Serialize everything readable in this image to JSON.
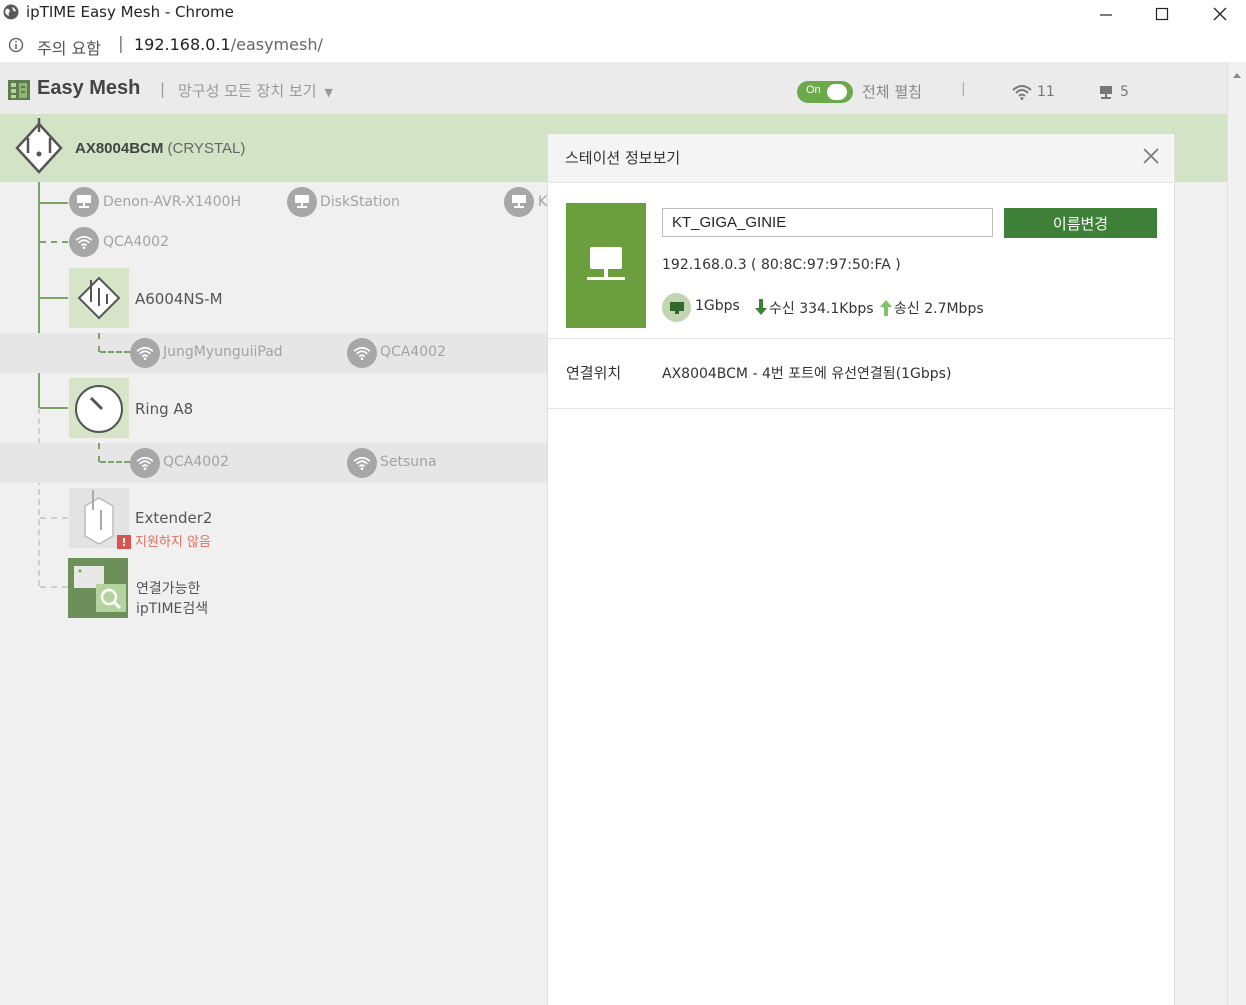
{
  "window": {
    "title": "ipTIME Easy Mesh - Chrome",
    "icon": "globe-icon",
    "controls": [
      "minimize-icon",
      "maximize-icon",
      "close-icon"
    ]
  },
  "address_bar": {
    "security_icon": "info-icon",
    "security_text": "주의 요함",
    "separator": "|",
    "host": "192.168.0.1",
    "path": "/easymesh/"
  },
  "header": {
    "logo_icon": "easymesh-logo-icon",
    "title": "Easy Mesh",
    "separator": "|",
    "view_select": "망구성 모든 장치 보기",
    "view_select_caret": "▼",
    "toggle_label": "On",
    "toggle_on": true,
    "expand_all": "전체 펼침",
    "separator2": "|",
    "wifi_count": "11",
    "wired_count": "5",
    "accent_color": "#6aaa4a"
  },
  "tree": {
    "root": {
      "name": "AX8004BCM",
      "model": "(CRYSTAL)",
      "icon": "router-icon"
    },
    "root_wired_clients": [
      {
        "label": "Denon-AVR-X1400H",
        "icon": "monitor-icon"
      },
      {
        "label": "DiskStation",
        "icon": "monitor-icon"
      },
      {
        "label": "K",
        "icon": "monitor-icon"
      }
    ],
    "root_wifi_clients": [
      {
        "label": "QCA4002",
        "icon": "wifi-icon"
      }
    ],
    "nodes": [
      {
        "name": "A6004NS-M",
        "icon": "router-icon",
        "clients": [
          {
            "label": "JungMyunguiiPad",
            "icon": "wifi-icon"
          },
          {
            "label": "QCA4002",
            "icon": "wifi-icon"
          }
        ]
      },
      {
        "name": "Ring A8",
        "icon": "ring-router-icon",
        "clients": [
          {
            "label": "QCA4002",
            "icon": "wifi-icon"
          },
          {
            "label": "Setsuna",
            "icon": "wifi-icon"
          }
        ]
      },
      {
        "name": "Extender2",
        "icon": "extender-icon",
        "warning_icon": "warning-icon",
        "status": "지원하지 않음"
      }
    ],
    "search": {
      "line1": "연결가능한",
      "line2": "ipTIME검색",
      "icon": "search-device-icon"
    }
  },
  "panel": {
    "title": "스테이션 정보보기",
    "close_icon": "close-icon",
    "station_icon": "monitor-icon",
    "name_value": "KT_GIGA_GINIE",
    "rename_button": "이름변경",
    "ip_mac": "192.168.0.3 ( 80:8C:97:97:50:FA )",
    "link_icon": "ethernet-icon",
    "speed": "1Gbps",
    "rx_icon": "download-arrow-icon",
    "rx": "수신 334.1Kbps",
    "tx_icon": "upload-arrow-icon",
    "tx": "송신 2.7Mbps",
    "location_label": "연결위치",
    "location_value": "AX8004BCM - 4번 포트에 유선연결됨(1Gbps)",
    "button_color": "#3e8038",
    "station_color": "#6b9f3e"
  }
}
